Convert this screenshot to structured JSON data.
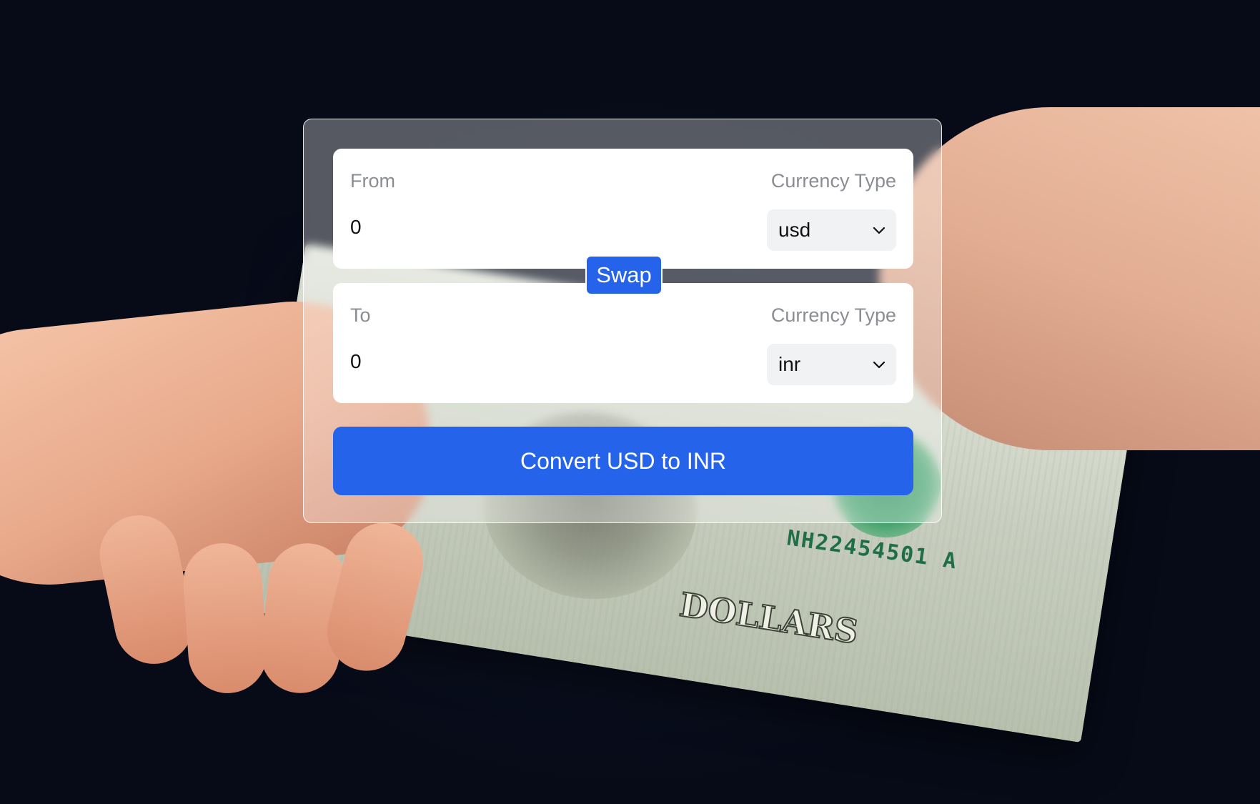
{
  "converter": {
    "from": {
      "label": "From",
      "currency_label": "Currency Type",
      "amount": "0",
      "currency": "usd"
    },
    "swap_label": "Swap",
    "to": {
      "label": "To",
      "currency_label": "Currency Type",
      "amount": "0",
      "currency": "inr"
    },
    "convert_label": "Convert USD to INR"
  },
  "background": {
    "bill_serial": "NH22454501 A",
    "bill_word": "DOLLARS"
  },
  "colors": {
    "accent": "#2563eb",
    "panel": "#ffffff",
    "label_text": "#8a8d93",
    "select_bg": "#f1f2f4"
  },
  "icons": {
    "dropdown": "chevron-down-icon"
  }
}
